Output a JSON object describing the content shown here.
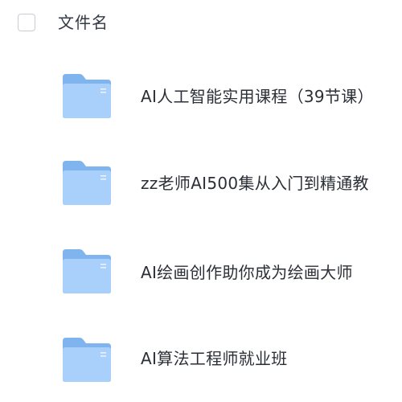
{
  "header": {
    "column_label": "文件名"
  },
  "files": [
    {
      "name": "AI人工智能实用课程（39节课）",
      "icon": "folder-icon"
    },
    {
      "name": "zz老师AI500集从入门到精通教",
      "icon": "folder-icon"
    },
    {
      "name": " AI绘画创作助你成为绘画大师",
      "icon": "folder-icon"
    },
    {
      "name": "AI算法工程师就业班",
      "icon": "folder-icon"
    }
  ],
  "colors": {
    "folder_back": "#7fb4ee",
    "folder_front": "#a9d0fb",
    "text": "#2b2f36"
  }
}
